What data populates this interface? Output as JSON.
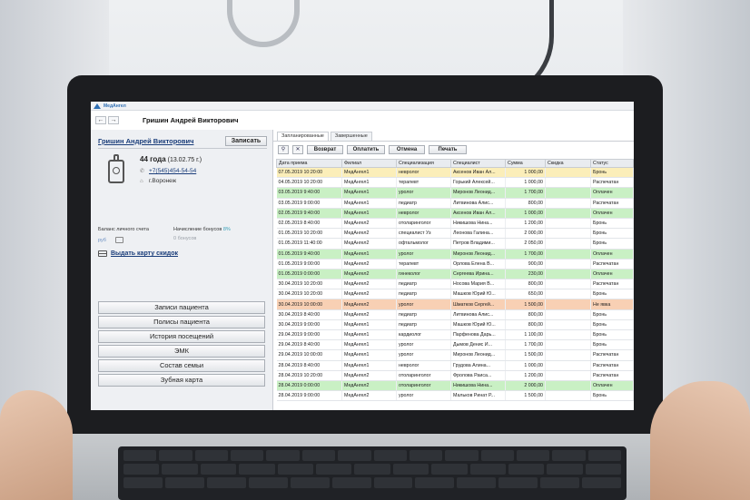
{
  "app": {
    "title": "МедАнгел"
  },
  "header": {
    "patient_name": "Гришин Андрей Викторович"
  },
  "patient": {
    "name": "Гришин Андрей Викторович",
    "record_button": "Записать",
    "age_strong": "44 года",
    "birth_date": "(13.02.75 г.)",
    "phone": "+7(545)454-54-54",
    "city": "г.Воронеж",
    "balance_label": "Баланс личного счета",
    "balance_unit": "руб",
    "bonus_label": "Начисление бонусов",
    "bonus_percent": "8%",
    "bonus_value": "0 бонусов",
    "card_link": "Выдать карту скидок"
  },
  "menu": [
    "Записи пациента",
    "Полисы пациента",
    "История посещений",
    "ЭМК",
    "Состав семьи",
    "Зубная карта"
  ],
  "tabs": [
    "Запланированные",
    "Завершенные"
  ],
  "toolbar": {
    "search_icon": "magnifier",
    "filter_icon": "clear-filter",
    "return": "Возврат",
    "pay": "Оплатить",
    "cancel": "Отмена",
    "print": "Печать"
  },
  "table": {
    "columns": [
      "Дата приема",
      "Филиал",
      "Специализация",
      "Специалист",
      "Сумма",
      "Скидка",
      "Статус"
    ],
    "rows": [
      {
        "state": "sel",
        "cells": [
          "07.05.2019 10:20:00",
          "МедАнгел1",
          "невролог",
          "Аксенов Иван Ал...",
          "1 000,00",
          "",
          "Бронь"
        ]
      },
      {
        "state": "booked",
        "cells": [
          "04.05.2019 10:20:00",
          "МедАнгел1",
          "терапевт",
          "Горький Алексей...",
          "1 000,00",
          "",
          "Распечатан"
        ]
      },
      {
        "state": "paid",
        "cells": [
          "03.05.2019 9:40:00",
          "МедАнгел1",
          "уролог",
          "Миронов Леонид...",
          "1 700,00",
          "",
          "Оплачен"
        ]
      },
      {
        "state": "booked",
        "cells": [
          "03.05.2019 9:00:00",
          "МедАнгел1",
          "педиатр",
          "Литвинова Алис...",
          "800,00",
          "",
          "Распечатан"
        ]
      },
      {
        "state": "paid",
        "cells": [
          "02.05.2019 9:40:00",
          "МедАнгел1",
          "невролог",
          "Аксенов Иван Ал...",
          "1 000,00",
          "",
          "Оплачен"
        ]
      },
      {
        "state": "booked",
        "cells": [
          "02.05.2019 8:40:00",
          "МедАнгел2",
          "отоларинголог",
          "Никишова Нина...",
          "1 200,00",
          "",
          "Бронь"
        ]
      },
      {
        "state": "booked",
        "cells": [
          "01.05.2019 10:20:00",
          "МедАнгел2",
          "специалист Уз",
          "Леонова Галина...",
          "2 000,00",
          "",
          "Бронь"
        ]
      },
      {
        "state": "booked",
        "cells": [
          "01.05.2019 11:40:00",
          "МедАнгел2",
          "офтальмолог",
          "Петров Владими...",
          "2 050,00",
          "",
          "Бронь"
        ]
      },
      {
        "state": "paid",
        "cells": [
          "01.05.2019 9:40:00",
          "МедАнгел1",
          "уролог",
          "Миронов Леонид...",
          "1 700,00",
          "",
          "Оплачен"
        ]
      },
      {
        "state": "booked",
        "cells": [
          "01.05.2019 9:00:00",
          "МедАнгел2",
          "терапевт",
          "Орлова Елена В...",
          "900,00",
          "",
          "Распечатан"
        ]
      },
      {
        "state": "paid",
        "cells": [
          "01.05.2019 0:00:00",
          "МедАнгел2",
          "гинеколог",
          "Сергеева Ирина...",
          "230,00",
          "",
          "Оплачен"
        ]
      },
      {
        "state": "booked",
        "cells": [
          "30.04.2019 10:20:00",
          "МедАнгел2",
          "педиатр",
          "Носова Мария В...",
          "800,00",
          "",
          "Распечатан"
        ]
      },
      {
        "state": "booked",
        "cells": [
          "30.04.2019 10:20:00",
          "МедАнгел2",
          "педиатр",
          "Машков Юрий Ю...",
          "650,00",
          "",
          "Бронь"
        ]
      },
      {
        "state": "noshow",
        "cells": [
          "30.04.2019 10:00:00",
          "МедАнгел2",
          "уролог",
          "Шматков Сергей...",
          "1 500,00",
          "",
          "Не явка"
        ]
      },
      {
        "state": "booked",
        "cells": [
          "30.04.2019 8:40:00",
          "МедАнгел2",
          "педиатр",
          "Литвинова Алис...",
          "800,00",
          "",
          "Бронь"
        ]
      },
      {
        "state": "booked",
        "cells": [
          "30.04.2019 9:00:00",
          "МедАнгел1",
          "педиатр",
          "Машков Юрий Ю...",
          "800,00",
          "",
          "Бронь"
        ]
      },
      {
        "state": "booked",
        "cells": [
          "29.04.2019 9:00:00",
          "МедАнгел1",
          "кардиолог",
          "Парфенова Дарь...",
          "1 100,00",
          "",
          "Бронь"
        ]
      },
      {
        "state": "booked",
        "cells": [
          "29.04.2019 8:40:00",
          "МедАнгел1",
          "уролог",
          "Дымов Денис И...",
          "1 700,00",
          "",
          "Бронь"
        ]
      },
      {
        "state": "booked",
        "cells": [
          "29.04.2019 10:00:00",
          "МедАнгел1",
          "уролог",
          "Миронов Леонид...",
          "1 500,00",
          "",
          "Распечатан"
        ]
      },
      {
        "state": "booked",
        "cells": [
          "28.04.2019 8:40:00",
          "МедАнгел1",
          "невролог",
          "Грудова Алина...",
          "1 000,00",
          "",
          "Распечатан"
        ]
      },
      {
        "state": "booked",
        "cells": [
          "28.04.2019 10:20:00",
          "МедАнгел2",
          "отоларинголог",
          "Фролова Раиса...",
          "1 200,00",
          "",
          "Распечатан"
        ]
      },
      {
        "state": "paid",
        "cells": [
          "28.04.2019 0:00:00",
          "МедАнгел2",
          "отоларинголог",
          "Никишова Нина...",
          "2 000,00",
          "",
          "Оплачен"
        ]
      },
      {
        "state": "booked",
        "cells": [
          "28.04.2019 9:00:00",
          "МедАнгел2",
          "уролог",
          "Мальков Ринат Р...",
          "1 500,00",
          "",
          "Бронь"
        ]
      }
    ]
  },
  "colors": {
    "selected_row": "#fbeeb9",
    "paid_row": "#c9f0c4",
    "noshow_row": "#f8d0b4",
    "link": "#1a3d7a",
    "brand": "#2f6fb3"
  }
}
